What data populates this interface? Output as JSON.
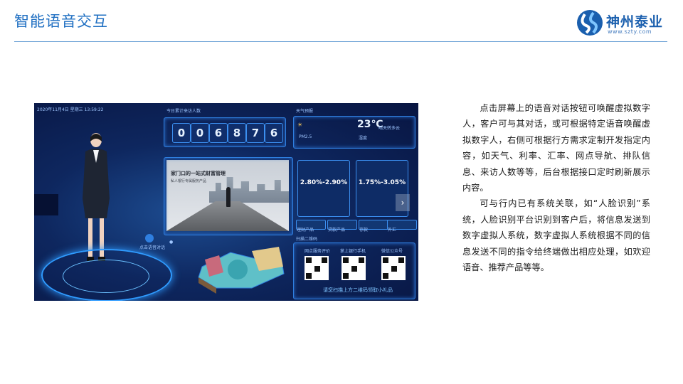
{
  "page": {
    "title": "智能语音交互"
  },
  "logo": {
    "name": "神州泰业",
    "url": "www.szty.com"
  },
  "screen": {
    "header_datetime": "2020年11月4日 星期三 13:59:22",
    "visitor_label": "今日累计来访人数",
    "counter_digits": [
      "0",
      "0",
      "6",
      "8",
      "7",
      "6"
    ],
    "weather_label": "天气预报",
    "weather_temp": "23℃",
    "weather_cond": "晴天转多云",
    "weather_humidity": "湿度",
    "weather_pm": "PM2.5",
    "news_title": "家门口的一站式财富管理",
    "news_sub": "私人银行专属服务产品",
    "rate_card_1": "2.80%-2.90%",
    "rate_card_2": "1.75%-3.05%",
    "buttons": [
      "理财产品",
      "贷款产品",
      "存款",
      "外汇"
    ],
    "scan_label": "扫描二维码",
    "qr_labels": [
      "网点服务评价",
      "掌上银行手机",
      "微信公众号"
    ],
    "scan_tip": "请您扫描上方二维码领取小礼品",
    "mic_label": "点击语音对话"
  },
  "description": {
    "paragraphs": [
      "点击屏幕上的语音对话按钮可唤醒虚拟数字人，客户可与其对话，或可根据特定语音唤醒虚拟数字人，右侧可根据行方需求定制开发指定内容，如天气、利率、汇率、网点导航、排队信息、来访人数等等，后台根据接口定时刷新展示内容。",
      "可与行内已有系统关联，如“人脸识别”系统，人脸识别平台识别到客户后，将信息发送到数字虚拟人系统，数字虚拟人系统根据不同的信息发送不同的指令给终端做出相应处理，如欢迎语音、推荐产品等等。"
    ]
  },
  "colors": {
    "title": "#1f6fc2",
    "divider": "#6fa3d6",
    "screen_bg": "#0b1d4a",
    "accent": "#3b8ff0"
  }
}
